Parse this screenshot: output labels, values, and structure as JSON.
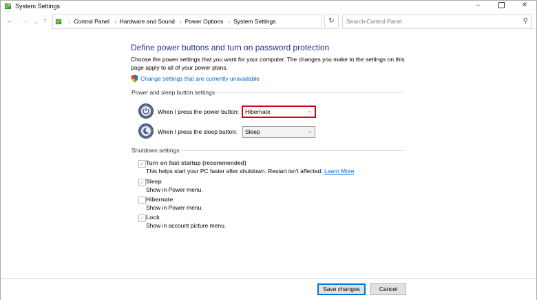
{
  "window": {
    "title": "System Settings",
    "minimize": "–",
    "close": "✕"
  },
  "nav": {
    "back": "←",
    "forward": "→",
    "recent": "⌄",
    "up": "↑",
    "breadcrumbs": [
      "Control Panel",
      "Hardware and Sound",
      "Power Options",
      "System Settings"
    ],
    "breadcrumb_separator": "›",
    "dropdown": "⌄",
    "refresh": "↻",
    "search_placeholder": "Search Control Panel",
    "search_glyph": "⚲"
  },
  "page": {
    "heading": "Define power buttons and turn on password protection",
    "description": "Choose the power settings that you want for your computer. The changes you make to the settings on this page apply to all of your power plans.",
    "change_link": "Change settings that are currently unavailable"
  },
  "power_sleep": {
    "section_label": "Power and sleep button settings",
    "power_button_label": "When I press the power button:",
    "power_button_value": "Hibernate",
    "sleep_button_label": "When I press the sleep button:",
    "sleep_button_value": "Sleep",
    "chevron": "⌄",
    "highlight_color": "#d0021b"
  },
  "shutdown": {
    "section_label": "Shutdown settings",
    "items": [
      {
        "title": "Turn on fast startup (recommended)",
        "desc": "This helps start your PC faster after shutdown. Restart isn't affected.",
        "link": "Learn More",
        "checked": true,
        "mark": "✓"
      },
      {
        "title": "Sleep",
        "desc": "Show in Power menu.",
        "checked": true,
        "mark": "✓"
      },
      {
        "title": "Hibernate",
        "desc": "Show in Power menu.",
        "checked": false,
        "mark": ""
      },
      {
        "title": "Lock",
        "desc": "Show in account picture menu.",
        "checked": true,
        "mark": "✓"
      }
    ]
  },
  "footer": {
    "save_label": "Save changes",
    "cancel_label": "Cancel"
  }
}
